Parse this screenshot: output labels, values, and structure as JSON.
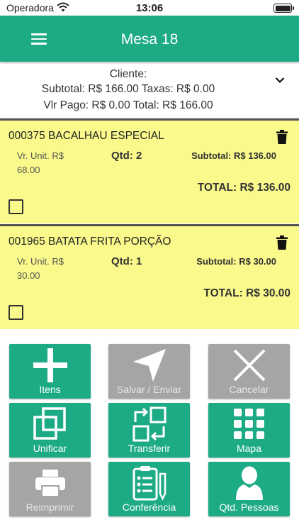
{
  "status_bar": {
    "carrier": "Operadora",
    "time": "13:06"
  },
  "header": {
    "title": "Mesa 18",
    "menu_icon": "hamburger-icon"
  },
  "summary": {
    "line1": "Cliente:",
    "line2": "Subtotal: R$ 166.00 Taxas: R$ 0.00",
    "line3": "Vlr Pago: R$ 0.00 Total: R$ 166.00",
    "toggle_icon": "chevron-down-icon"
  },
  "items": [
    {
      "name": "000375 BACALHAU ESPECIAL",
      "unit_label": "Vr. Unit. R$",
      "unit_value": "68.00",
      "qty": "Qtd: 2",
      "subtotal": "Subtotal: R$ 136.00",
      "total": "TOTAL: R$ 136.00"
    },
    {
      "name": "001965 BATATA FRITA PORÇÃO",
      "unit_label": "Vr. Unit. R$",
      "unit_value": "30.00",
      "qty": "Qtd: 1",
      "subtotal": "Subtotal: R$ 30.00",
      "total": "TOTAL: R$ 30.00"
    }
  ],
  "actions": [
    {
      "label": "Itens",
      "icon": "plus-icon",
      "enabled": true
    },
    {
      "label": "Salvar / Enviar",
      "icon": "send-icon",
      "enabled": false
    },
    {
      "label": "Cancelar",
      "icon": "close-icon",
      "enabled": false
    },
    {
      "label": "Unificar",
      "icon": "merge-icon",
      "enabled": true
    },
    {
      "label": "Transferir",
      "icon": "transfer-icon",
      "enabled": true
    },
    {
      "label": "Mapa",
      "icon": "grid-map-icon",
      "enabled": true
    },
    {
      "label": "Reimprimir",
      "icon": "printer-icon",
      "enabled": false
    },
    {
      "label": "Conferência",
      "icon": "checklist-icon",
      "enabled": true
    },
    {
      "label": "Qtd. Pessoas",
      "icon": "person-icon",
      "enabled": true
    }
  ],
  "colors": {
    "primary": "#1dab86",
    "item_bg": "#fafa8c",
    "disabled": "#a5a5a5"
  }
}
